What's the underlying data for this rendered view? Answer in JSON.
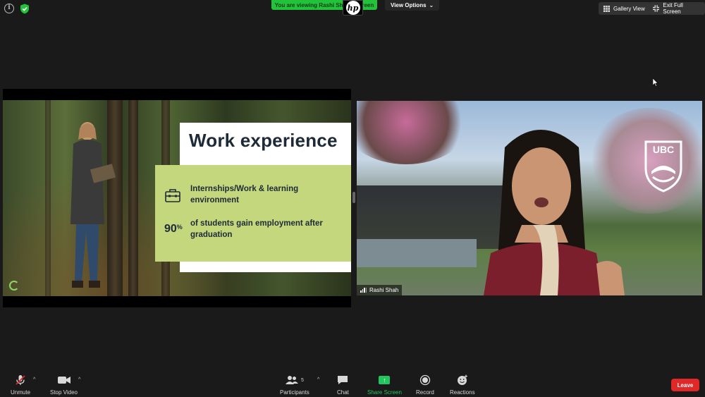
{
  "banner": {
    "text": "You are viewing Rashi Shah's screen"
  },
  "top": {
    "view_options": "View Options",
    "gallery_view": "Gallery View",
    "exit_full_screen": "Exit Full Screen",
    "brand_logo_text": "hp"
  },
  "slide": {
    "title": "Work experience",
    "item1": "Internships/Work & learning environment",
    "stat_value": "90",
    "stat_unit": "%",
    "item2": "of students gain employment after graduation"
  },
  "speaker": {
    "name": "Rashi Shah",
    "logo_text": "UBC"
  },
  "toolbar": {
    "unmute": "Unmute",
    "stop_video": "Stop Video",
    "participants": "Participants",
    "participants_count": "5",
    "chat": "Chat",
    "share_screen": "Share Screen",
    "record": "Record",
    "reactions": "Reactions",
    "leave": "Leave"
  },
  "colors": {
    "banner_green": "#23c23b",
    "slide_green": "#c4d77c",
    "share_green": "#22c55e",
    "leave_red": "#e02828"
  }
}
